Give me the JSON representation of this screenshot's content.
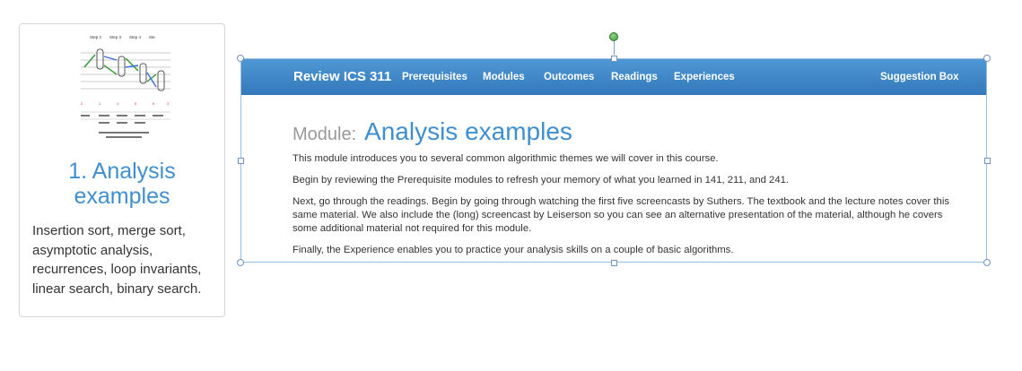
{
  "card": {
    "thumbnail_labels": [
      "Step 2",
      "Step 3",
      "Step 4",
      "Ste"
    ],
    "title": "1. Analysis examples",
    "description": "Insertion sort, merge sort, asymptotic analysis, recurrences, loop invariants, linear search, binary search."
  },
  "page": {
    "nav": {
      "brand": "Review ICS 311",
      "items": [
        "Prerequisites",
        "Modules",
        "Outcomes",
        "Readings",
        "Experiences"
      ],
      "suggestion": "Suggestion Box"
    },
    "heading_prefix": "Module:",
    "heading_name": "Analysis examples",
    "paragraphs": [
      "This module introduces you to several common algorithmic themes we will cover in this course.",
      "Begin by reviewing the Prerequisite modules to refresh your memory of what you learned in 141, 211, and 241.",
      "Next, go through the readings. Begin by going through watching the first five screencasts by Suthers. The textbook and the lecture notes cover this same material. We also include the (long) screencast by Leiserson so you can see an alternative presentation of the material, although he covers some additional material not required for this module.",
      "Finally, the Experience enables you to practice your analysis skills on a couple of basic algorithms."
    ]
  },
  "colors": {
    "accent": "#3f8fd0",
    "navbar": "#3a80c2",
    "selection": "#9dbde0",
    "rotate_handle": "#4caf50"
  }
}
